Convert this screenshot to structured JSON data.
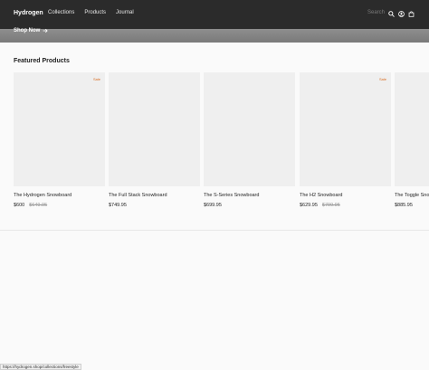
{
  "header": {
    "logo": "Hydrogen",
    "nav": [
      "Collections",
      "Products",
      "Journal"
    ],
    "search_label": "Search",
    "icons": [
      "search-icon",
      "account-icon",
      "cart-icon"
    ]
  },
  "hero": {
    "cta": "Shop Now",
    "cta_icon": "arrow-right-icon"
  },
  "featured": {
    "title": "Featured Products",
    "products": [
      {
        "title": "The Hydrogen Snowboard",
        "price": "$600",
        "compare": "$649.95",
        "sale": "Sale"
      },
      {
        "title": "The Full Stack Snowboard",
        "price": "$749.95",
        "compare": "",
        "sale": ""
      },
      {
        "title": "The S-Series Snowboard",
        "price": "$699.95",
        "compare": "",
        "sale": ""
      },
      {
        "title": "The H2 Snowboard",
        "price": "$629.95",
        "compare": "$799.95",
        "sale": "Sale"
      },
      {
        "title": "The Toggle Snowboard",
        "price": "$885.95",
        "compare": "",
        "sale": ""
      }
    ]
  },
  "statusbar": {
    "url": "https://hydrogen.shop/collections/freestyle"
  },
  "colors": {
    "header_bg": "#2b2b2b",
    "sale": "#d86a1e"
  }
}
